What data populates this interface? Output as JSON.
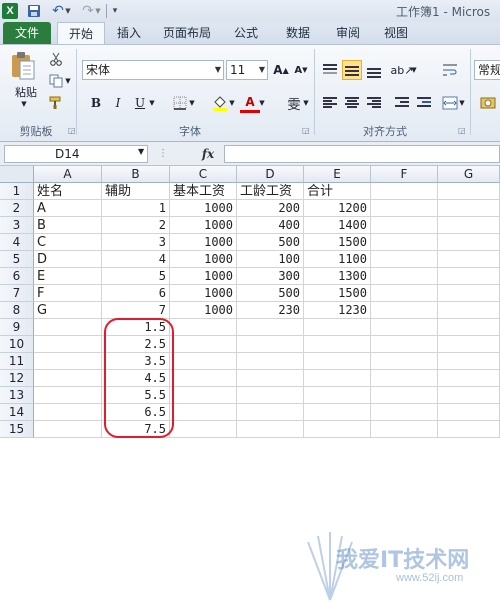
{
  "app": {
    "window_title": "工作簿1 - Micros",
    "logo_letter": "X"
  },
  "ribbon_tabs": [
    {
      "label": "文件"
    },
    {
      "label": "开始"
    },
    {
      "label": "插入"
    },
    {
      "label": "页面布局"
    },
    {
      "label": "公式"
    },
    {
      "label": "数据"
    },
    {
      "label": "审阅"
    },
    {
      "label": "视图"
    }
  ],
  "ribbon": {
    "clipboard": {
      "paste_label": "粘贴",
      "group_label": "剪贴板"
    },
    "font": {
      "font_name": "宋体",
      "font_size": "11",
      "group_label": "字体"
    },
    "alignment": {
      "group_label": "对齐方式"
    },
    "number": {
      "format": "常规"
    }
  },
  "formula_bar": {
    "name_box": "D14",
    "fx_label": "fx",
    "formula": ""
  },
  "sheet": {
    "columns": [
      "A",
      "B",
      "C",
      "D",
      "E",
      "F",
      "G"
    ],
    "rows": [
      {
        "num": "1",
        "A": "姓名",
        "B": "辅助",
        "C": "基本工资",
        "D": "工龄工资",
        "E": "合计"
      },
      {
        "num": "2",
        "A": "A",
        "B": "1",
        "C": "1000",
        "D": "200",
        "E": "1200"
      },
      {
        "num": "3",
        "A": "B",
        "B": "2",
        "C": "1000",
        "D": "400",
        "E": "1400"
      },
      {
        "num": "4",
        "A": "C",
        "B": "3",
        "C": "1000",
        "D": "500",
        "E": "1500"
      },
      {
        "num": "5",
        "A": "D",
        "B": "4",
        "C": "1000",
        "D": "100",
        "E": "1100"
      },
      {
        "num": "6",
        "A": "E",
        "B": "5",
        "C": "1000",
        "D": "300",
        "E": "1300"
      },
      {
        "num": "7",
        "A": "F",
        "B": "6",
        "C": "1000",
        "D": "500",
        "E": "1500"
      },
      {
        "num": "8",
        "A": "G",
        "B": "7",
        "C": "1000",
        "D": "230",
        "E": "1230"
      },
      {
        "num": "9",
        "A": "",
        "B": "1.5",
        "C": "",
        "D": "",
        "E": ""
      },
      {
        "num": "10",
        "A": "",
        "B": "2.5",
        "C": "",
        "D": "",
        "E": ""
      },
      {
        "num": "11",
        "A": "",
        "B": "3.5",
        "C": "",
        "D": "",
        "E": ""
      },
      {
        "num": "12",
        "A": "",
        "B": "4.5",
        "C": "",
        "D": "",
        "E": ""
      },
      {
        "num": "13",
        "A": "",
        "B": "5.5",
        "C": "",
        "D": "",
        "E": ""
      },
      {
        "num": "14",
        "A": "",
        "B": "6.5",
        "C": "",
        "D": "",
        "E": ""
      },
      {
        "num": "15",
        "A": "",
        "B": "7.5",
        "C": "",
        "D": "",
        "E": ""
      }
    ]
  },
  "watermark": {
    "text": "我爱IT技术网",
    "url": "www.52ij.com"
  },
  "colors": {
    "file_tab": "#2a7d3d",
    "highlight": "#ffe28a",
    "annotation": "#e31b2a"
  }
}
